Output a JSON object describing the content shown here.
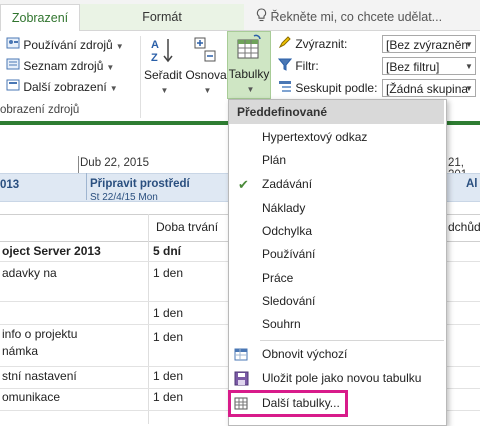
{
  "tabs": {
    "zobrazeni": "Zobrazení",
    "format": "Formát",
    "tell_me": "Řekněte mi, co chcete udělat..."
  },
  "ribbon": {
    "resource_usage": "Používání zdrojů",
    "resource_list": "Seznam zdrojů",
    "other_views": "Další zobrazení",
    "group_label": "obrazení zdrojů",
    "sort": "Seřadit",
    "outline": "Osnova",
    "tables": "Tabulky",
    "highlight_label": "Zvýraznit:",
    "highlight_value": "[Bez zvýrazněn",
    "filter_label": "Filtr:",
    "filter_value": "[Bez filtru]",
    "group_by_label": "Seskupit podle:",
    "group_by_value": "[Žádná skupina"
  },
  "timeline": {
    "date1": "Dub 22, 2015",
    "date_right": "21, 201",
    "band_left": "013",
    "band_task": "Připravit prostředí",
    "band_task_sub": "St 22/4/15 Mon",
    "band_right": "Al"
  },
  "grid": {
    "col_duration": "Doba trvání",
    "col_right": "dchůdc",
    "rows": [
      {
        "name": "oject Server 2013",
        "duration": "5 dní"
      },
      {
        "name": "adavky na",
        "duration": "1 den"
      },
      {
        "name": "",
        "duration": "1 den"
      },
      {
        "name": "info o projektu",
        "name2": "námka",
        "duration": "1 den"
      },
      {
        "name": "stní nastavení",
        "duration": "1 den"
      },
      {
        "name": "omunikace",
        "duration": "1 den"
      }
    ]
  },
  "menu": {
    "header": "Předdefinované",
    "items": [
      "Hypertextový odkaz",
      "Plán",
      "Zadávání",
      "Náklady",
      "Odchylka",
      "Používání",
      "Práce",
      "Sledování",
      "Souhrn"
    ],
    "checked_index": 2,
    "reset": "Obnovit výchozí",
    "save": "Uložit pole jako novou tabulku",
    "more": "Další tabulky..."
  },
  "colors": {
    "accent_green": "#2e7d32",
    "highlight_magenta": "#d81b8a"
  }
}
